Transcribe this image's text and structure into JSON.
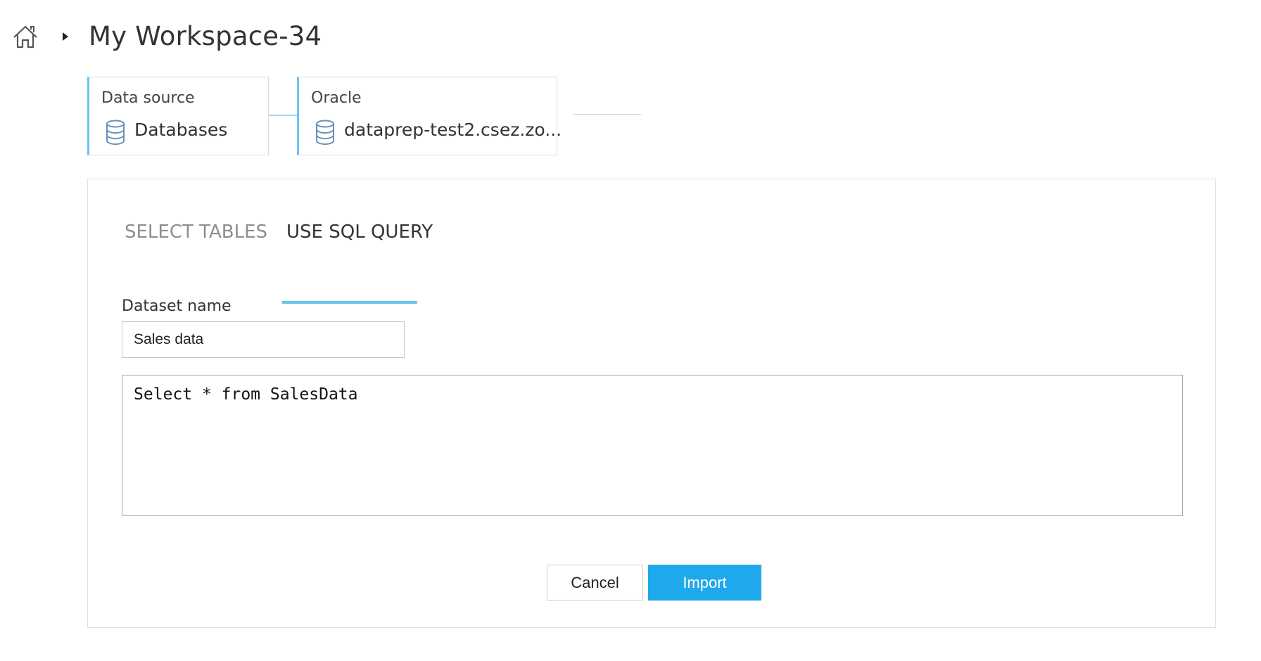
{
  "header": {
    "title": "My Workspace-34",
    "home_icon": "home-icon",
    "separator_icon": "caret-right-icon"
  },
  "pipeline": {
    "steps": [
      {
        "label": "Data source",
        "value": "Databases",
        "icon": "database-icon"
      },
      {
        "label": "Oracle",
        "value": "dataprep-test2.csez.zo...",
        "icon": "database-icon"
      }
    ]
  },
  "import_panel": {
    "tabs": [
      {
        "label": "SELECT TABLES",
        "active": false
      },
      {
        "label": "USE SQL QUERY",
        "active": true
      }
    ],
    "dataset_name_label": "Dataset name",
    "dataset_name_value": "Sales data",
    "sql_query": "Select * from SalesData",
    "cancel_label": "Cancel",
    "import_label": "Import"
  },
  "colors": {
    "accent": "#69c6ef",
    "primary_button": "#1fa9ec",
    "text": "#333333",
    "inactive_tab": "#8e8e8e"
  }
}
